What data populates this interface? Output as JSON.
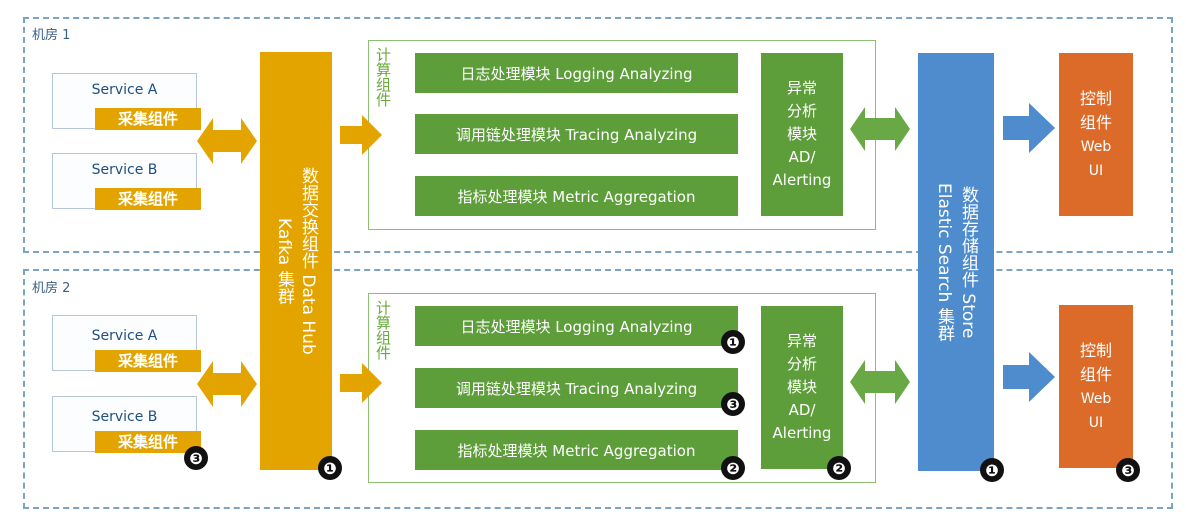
{
  "rooms": [
    {
      "label": "机房 1",
      "services": [
        {
          "name": "Service A",
          "collector": "采集组件"
        },
        {
          "name": "Service B",
          "collector": "采集组件"
        }
      ],
      "compute": {
        "title": "计算组件",
        "modules": [
          "日志处理模块 Logging Analyzing",
          "调用链处理模块 Tracing Analyzing",
          "指标处理模块 Metric Aggregation"
        ],
        "ad": [
          "异常",
          "分析",
          "模块",
          "AD/",
          "Alerting"
        ]
      },
      "console": [
        "控制",
        "组件",
        "Web",
        "UI"
      ]
    },
    {
      "label": "机房 2",
      "services": [
        {
          "name": "Service A",
          "collector": "采集组件"
        },
        {
          "name": "Service B",
          "collector": "采集组件"
        }
      ],
      "compute": {
        "title": "计算组件",
        "modules": [
          "日志处理模块 Logging Analyzing",
          "调用链处理模块 Tracing Analyzing",
          "指标处理模块 Metric Aggregation"
        ],
        "ad": [
          "异常",
          "分析",
          "模块",
          "AD/",
          "Alerting"
        ]
      },
      "console": [
        "控制",
        "组件",
        "Web",
        "UI"
      ]
    }
  ],
  "kafka": {
    "line1": "数据交换组件 Data Hub",
    "line2": "Kafka 集群"
  },
  "storage": {
    "line1": "数据存储组件 Store",
    "line2": "Elastic Search 集群"
  },
  "badges": {
    "collector_b": "❸",
    "kafka": "❶",
    "logging": "❶",
    "tracing": "❸",
    "metric": "❷",
    "ad": "❷",
    "storage": "❶",
    "console": "❸"
  },
  "colors": {
    "room_border": "#7aa3c4",
    "collector": "#e3a400",
    "compute": "#5d9e3b",
    "storage": "#4e8ccd",
    "console": "#dc6b2a"
  }
}
